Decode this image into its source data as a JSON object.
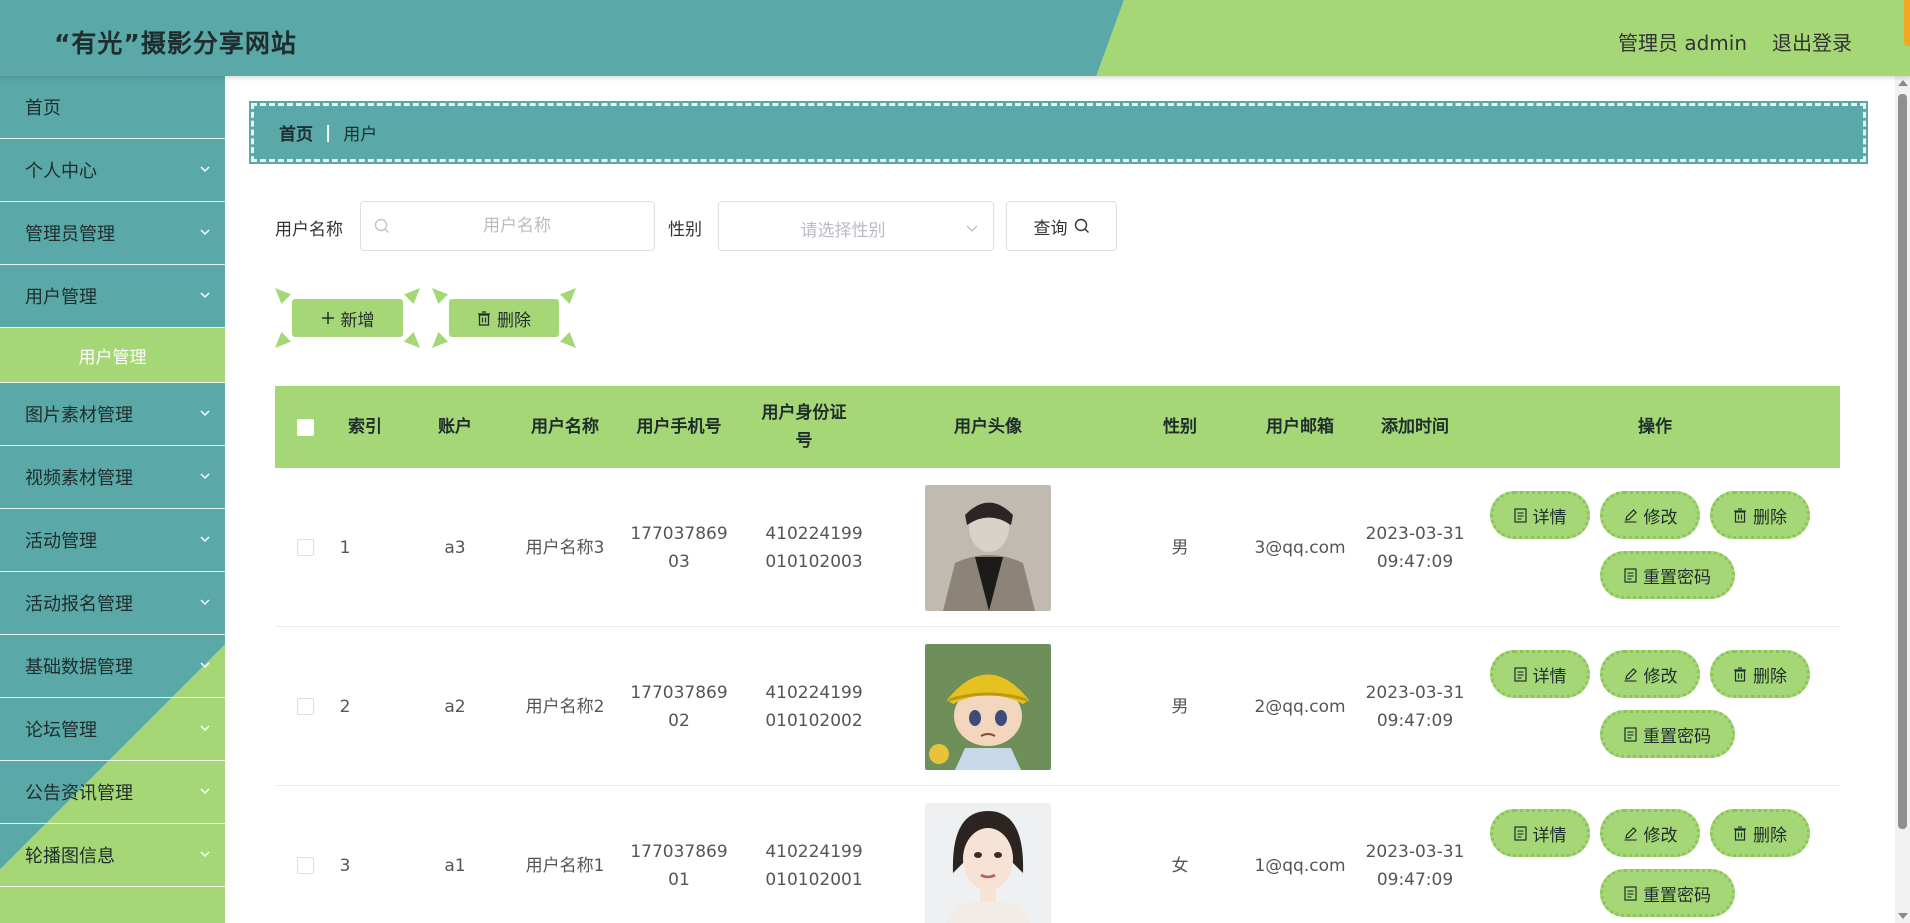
{
  "header": {
    "title": "“有光”摄影分享网站",
    "user": "管理员 admin",
    "logout": "退出登录"
  },
  "sidebar": {
    "items": [
      {
        "label": "首页"
      },
      {
        "label": "个人中心"
      },
      {
        "label": "管理员管理"
      },
      {
        "label": "用户管理"
      },
      {
        "label": "图片素材管理"
      },
      {
        "label": "视频素材管理"
      },
      {
        "label": "活动管理"
      },
      {
        "label": "活动报名管理"
      },
      {
        "label": "基础数据管理"
      },
      {
        "label": "论坛管理"
      },
      {
        "label": "公告资讯管理"
      },
      {
        "label": "轮播图信息"
      }
    ],
    "sub_item": "用户管理"
  },
  "breadcrumb": {
    "home": "首页",
    "current": "用户"
  },
  "search": {
    "name_label": "用户名称",
    "name_placeholder": "用户名称",
    "gender_label": "性别",
    "gender_placeholder": "请选择性别",
    "query_label": "查询"
  },
  "actions": {
    "add": "新增",
    "delete": "删除"
  },
  "table": {
    "headers": {
      "index": "索引",
      "account": "账户",
      "name": "用户名称",
      "phone": "用户手机号",
      "idcard": "用户身份证号",
      "avatar": "用户头像",
      "gender": "性别",
      "email": "用户邮箱",
      "time": "添加时间",
      "ops": "操作"
    },
    "ops": {
      "detail": "详情",
      "edit": "修改",
      "delete": "删除",
      "reset": "重置密码"
    },
    "rows": [
      {
        "index": "1",
        "account": "a3",
        "name": "用户名称3",
        "phone1": "177037869",
        "phone2": "03",
        "id1": "410224199",
        "id2": "010102003",
        "gender": "男",
        "email": "3@qq.com",
        "date": "2023-03-31",
        "time": "09:47:09"
      },
      {
        "index": "2",
        "account": "a2",
        "name": "用户名称2",
        "phone1": "177037869",
        "phone2": "02",
        "id1": "410224199",
        "id2": "010102002",
        "gender": "男",
        "email": "2@qq.com",
        "date": "2023-03-31",
        "time": "09:47:09"
      },
      {
        "index": "3",
        "account": "a1",
        "name": "用户名称1",
        "phone1": "177037869",
        "phone2": "01",
        "id1": "410224199",
        "id2": "010102001",
        "gender": "女",
        "email": "1@qq.com",
        "date": "2023-03-31",
        "time": "09:47:09"
      }
    ]
  },
  "colors": {
    "teal": "#5aa8a8",
    "green": "#a6d776",
    "accent": "#f5a623"
  }
}
